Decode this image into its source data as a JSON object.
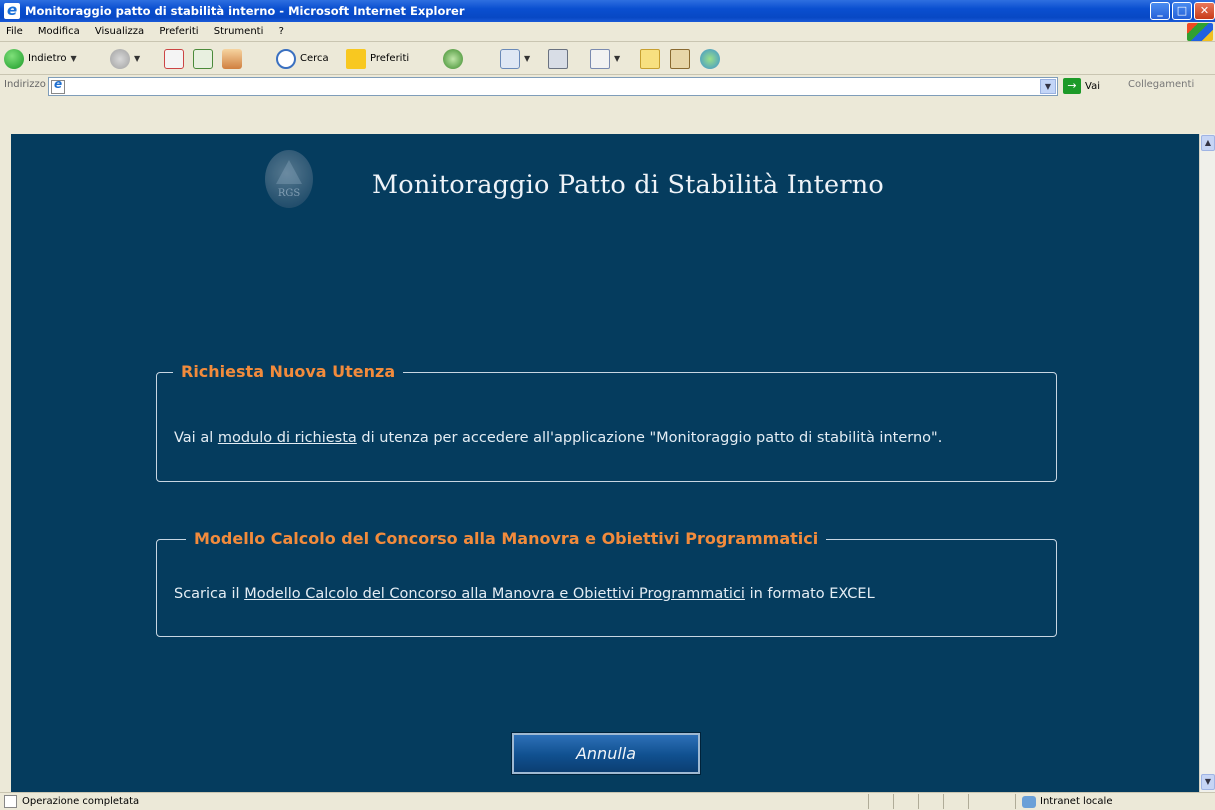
{
  "window": {
    "title": "Monitoraggio patto di stabilità interno - Microsoft Internet Explorer",
    "minimize": "_",
    "maximize": "□",
    "close": "✕"
  },
  "menu": [
    "File",
    "Modifica",
    "Visualizza",
    "Preferiti",
    "Strumenti",
    "?"
  ],
  "toolbar": {
    "back": "Indietro",
    "search": "Cerca",
    "favorites": "Preferiti"
  },
  "address": {
    "label": "Indirizzo",
    "value": "",
    "go": "Vai",
    "links": "Collegamenti"
  },
  "page": {
    "logo_text": "RGS",
    "title": "Monitoraggio Patto di Stabilità Interno",
    "request": {
      "legend": "Richiesta Nuova Utenza",
      "text_before": "Vai al ",
      "link": "modulo di richiesta",
      "text_after": " di utenza per accedere all'applicazione \"Monitoraggio patto di stabilità interno\"."
    },
    "model": {
      "legend": "Modello Calcolo del Concorso alla Manovra e Obiettivi Programmatici",
      "text_before": "Scarica il ",
      "link": "Modello Calcolo del Concorso alla Manovra e Obiettivi Programmatici",
      "text_after": " in formato EXCEL"
    },
    "cancel_button": "Annulla"
  },
  "status": {
    "text": "Operazione completata",
    "zone": "Intranet locale"
  },
  "colors": {
    "page_background": "#053c5e",
    "legend": "#f28b3c"
  }
}
